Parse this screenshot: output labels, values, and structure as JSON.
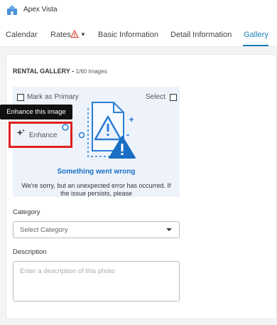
{
  "app": {
    "title": "Apex Vista"
  },
  "tabs": [
    {
      "label": "Calendar"
    },
    {
      "label": "Rates",
      "has_warning": true
    },
    {
      "label": "Basic Information"
    },
    {
      "label": "Detail Information"
    },
    {
      "label": "Gallery",
      "active": true
    }
  ],
  "gallery": {
    "title": "RENTAL GALLERY - ",
    "count": "1/60 Images",
    "mark_primary_label": "Mark as Primary",
    "select_label": "Select",
    "tooltip": "Enhance this image",
    "enhance_label": "Enhance",
    "error_title": "Something went wrong",
    "error_text": "We're sorry, but an unexpected error has occurred. If the issue persists, please"
  },
  "category": {
    "label": "Category",
    "value": "Select Category"
  },
  "description": {
    "label": "Description",
    "placeholder": "Enter a description of this photo"
  },
  "colors": {
    "accent": "#1e7fb8",
    "error_blue": "#1a6fc4",
    "highlight": "#e02020"
  }
}
